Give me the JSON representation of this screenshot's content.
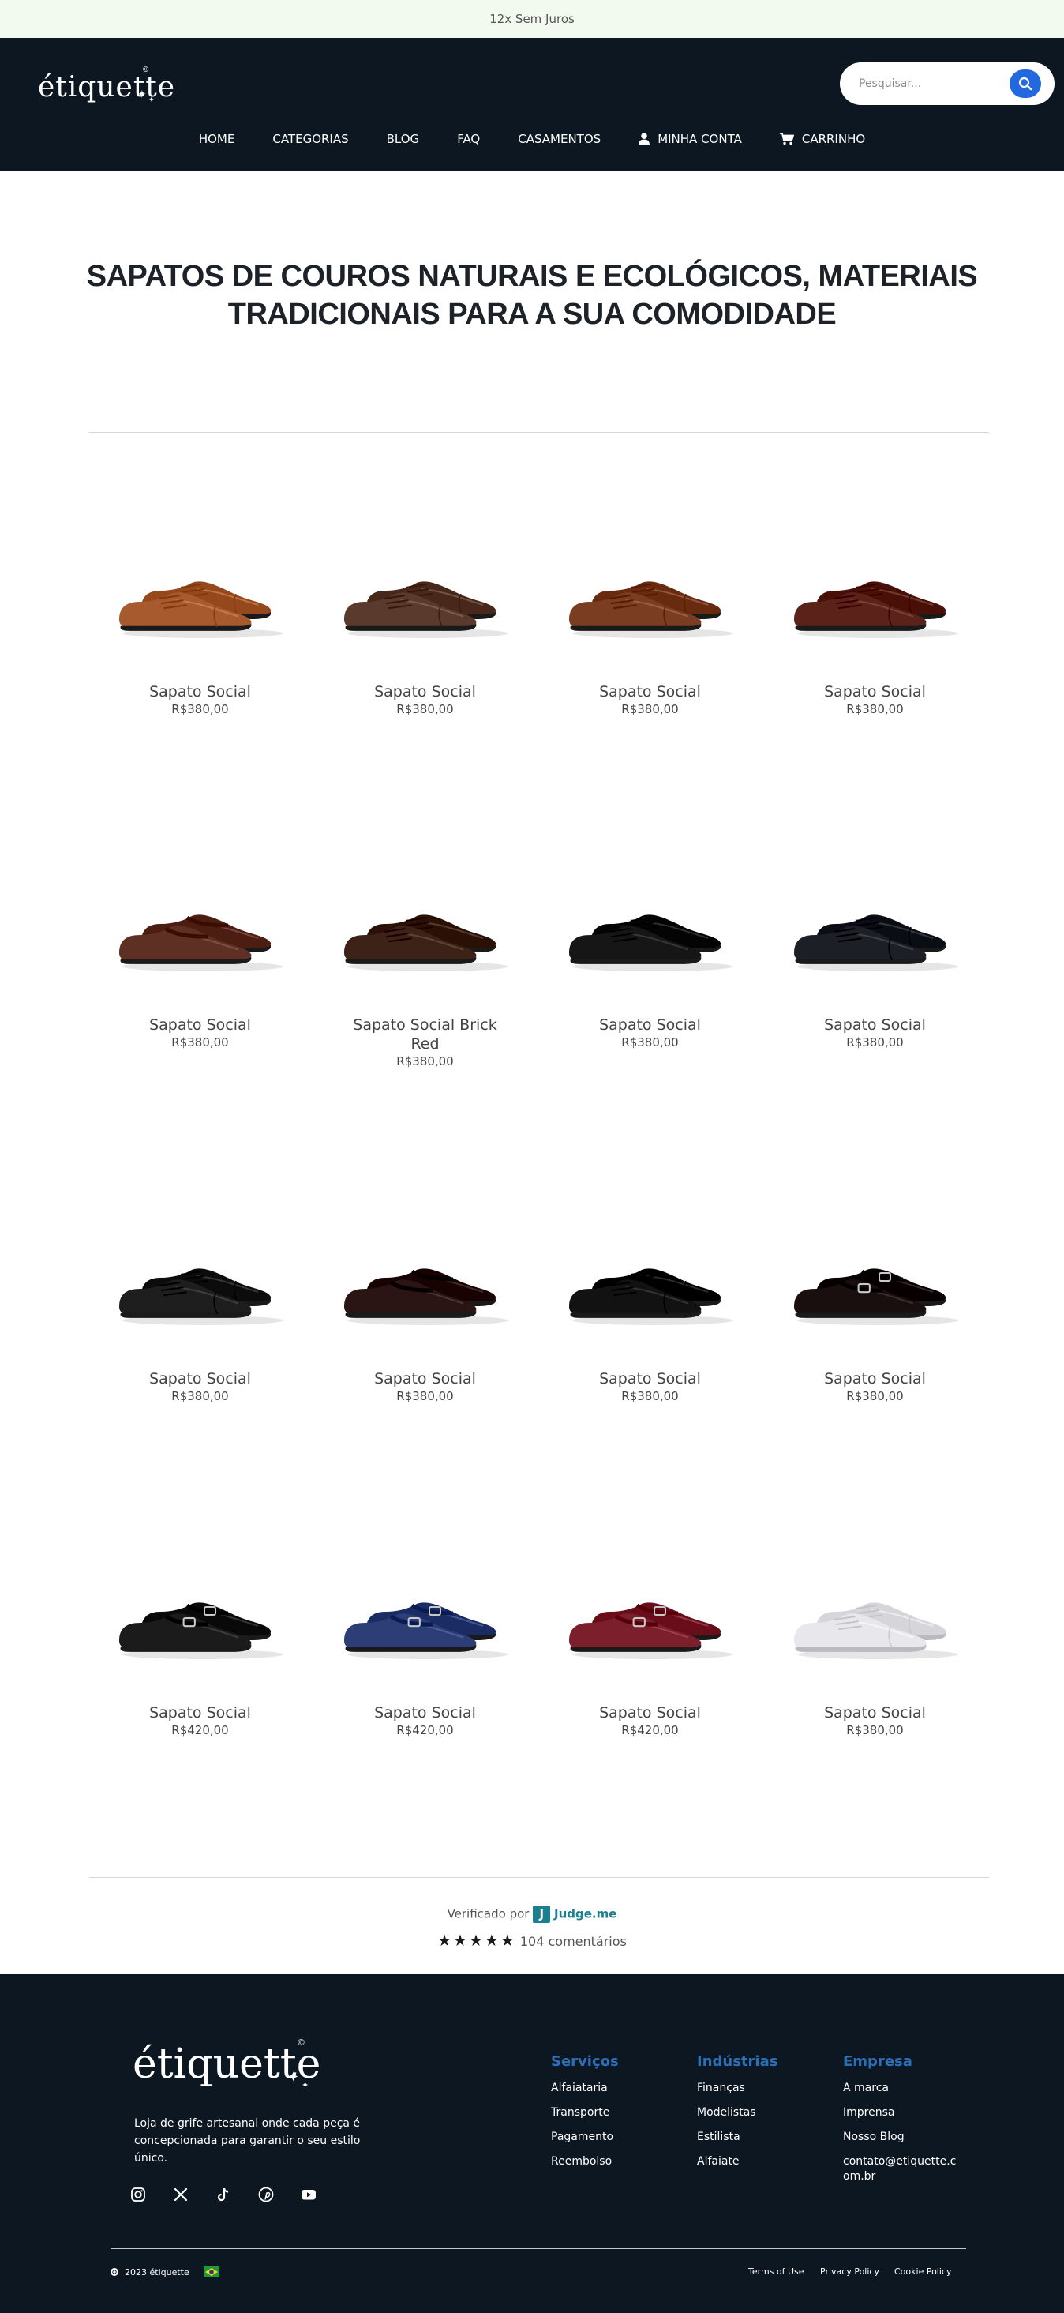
{
  "announcement": "12x Sem Juros",
  "header": {
    "logo": "étiquette",
    "search_placeholder": "Pesquisar...",
    "nav": [
      "HOME",
      "CATEGORIAS",
      "BLOG",
      "FAQ",
      "CASAMENTOS",
      "MINHA CONTA",
      "CARRINHO"
    ]
  },
  "heading": {
    "line1": "SAPATOS DE COUROS NATURAIS E ECOLÓGICOS, MATERIAIS",
    "line2": "TRADICIONAIS PARA A SUA COMODIDADE"
  },
  "products": [
    {
      "name": "Sapato Social",
      "price": "R$380,00",
      "color": "#a65a2e",
      "style": "oxford-light"
    },
    {
      "name": "Sapato Social",
      "price": "R$380,00",
      "color": "#5a3a2c",
      "style": "oxford"
    },
    {
      "name": "Sapato Social",
      "price": "R$380,00",
      "color": "#7a3d22",
      "style": "oxford"
    },
    {
      "name": "Sapato Social",
      "price": "R$380,00",
      "color": "#5a2218",
      "style": "oxford"
    },
    {
      "name": "Sapato Social",
      "price": "R$380,00",
      "color": "#5e2f23",
      "style": "loafer"
    },
    {
      "name": "Sapato Social Brick Red",
      "price": "R$380,00",
      "color": "#3d2218",
      "style": "derby"
    },
    {
      "name": "Sapato Social",
      "price": "R$380,00",
      "color": "#161616",
      "style": "derby"
    },
    {
      "name": "Sapato Social",
      "price": "R$380,00",
      "color": "#1d1f27",
      "style": "oxford"
    },
    {
      "name": "Sapato Social",
      "price": "R$380,00",
      "color": "#1e1e1e",
      "style": "oxford"
    },
    {
      "name": "Sapato Social",
      "price": "R$380,00",
      "color": "#2a1414",
      "style": "loafer"
    },
    {
      "name": "Sapato Social",
      "price": "R$380,00",
      "color": "#121212",
      "style": "oxford"
    },
    {
      "name": "Sapato Social",
      "price": "R$380,00",
      "color": "#1a0f0f",
      "style": "buckle"
    },
    {
      "name": "Sapato Social",
      "price": "R$420,00",
      "color": "#1b1b1b",
      "style": "buckle"
    },
    {
      "name": "Sapato Social",
      "price": "R$420,00",
      "color": "#2d3d75",
      "style": "buckle"
    },
    {
      "name": "Sapato Social",
      "price": "R$420,00",
      "color": "#7a1f2b",
      "style": "buckle"
    },
    {
      "name": "Sapato Social",
      "price": "R$380,00",
      "color": "#e8e8ec",
      "style": "oxford"
    }
  ],
  "reviews": {
    "verified_text": "Verificado por",
    "judge_letter": "J",
    "judge_name": "Judge.me",
    "stars": "★★★★★",
    "count_text": "104 comentários"
  },
  "footer": {
    "logo": "étiquette",
    "description": "Loja de grife artesanal onde cada peça é concepcionada para garantir o seu estilo único.",
    "columns": [
      {
        "title": "Serviços",
        "links": [
          "Alfaiataria",
          "Transporte",
          "Pagamento",
          "Reembolso"
        ]
      },
      {
        "title": "Indústrias",
        "links": [
          "Finanças",
          "Modelistas",
          "Estilista",
          "Alfaiate"
        ]
      },
      {
        "title": "Empresa",
        "links": [
          "A marca",
          "Imprensa",
          "Nosso Blog",
          "contato@etiquette.com.br"
        ]
      }
    ],
    "copyright": "2023 étiquette",
    "legal": [
      "Terms of Use",
      "Privacy Policy",
      "Cookie Policy"
    ]
  },
  "colors": {
    "header_bg": "#0c1721",
    "announce_bg": "#f2f9ef",
    "accent_blue": "#2468e0",
    "footer_heading": "#2d6fb6"
  }
}
